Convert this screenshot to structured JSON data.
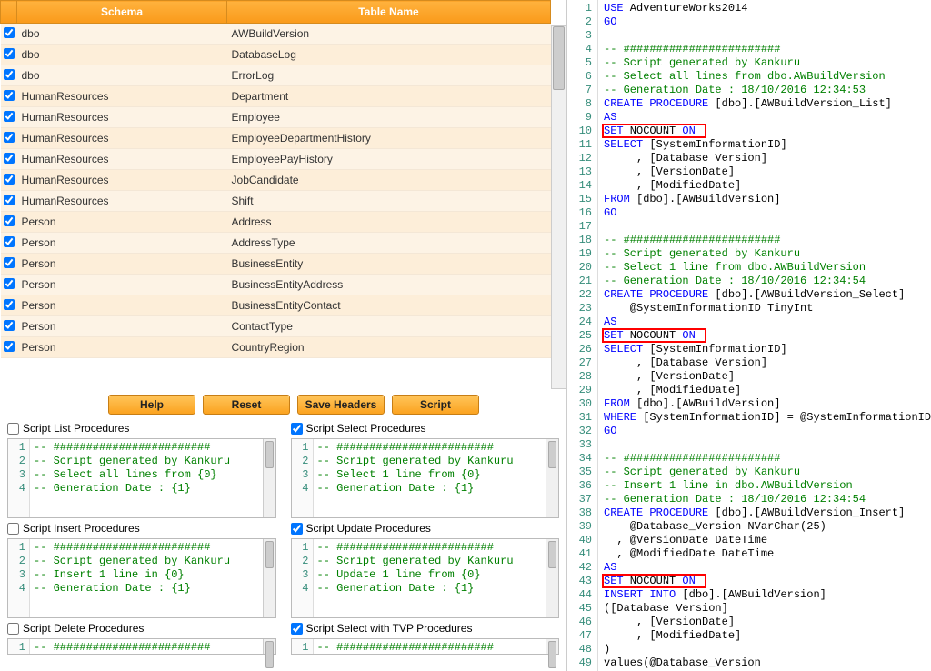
{
  "table": {
    "headers": {
      "schema": "Schema",
      "name": "Table Name"
    },
    "rows": [
      {
        "schema": "dbo",
        "name": "AWBuildVersion"
      },
      {
        "schema": "dbo",
        "name": "DatabaseLog"
      },
      {
        "schema": "dbo",
        "name": "ErrorLog"
      },
      {
        "schema": "HumanResources",
        "name": "Department"
      },
      {
        "schema": "HumanResources",
        "name": "Employee"
      },
      {
        "schema": "HumanResources",
        "name": "EmployeeDepartmentHistory"
      },
      {
        "schema": "HumanResources",
        "name": "EmployeePayHistory"
      },
      {
        "schema": "HumanResources",
        "name": "JobCandidate"
      },
      {
        "schema": "HumanResources",
        "name": "Shift"
      },
      {
        "schema": "Person",
        "name": "Address"
      },
      {
        "schema": "Person",
        "name": "AddressType"
      },
      {
        "schema": "Person",
        "name": "BusinessEntity"
      },
      {
        "schema": "Person",
        "name": "BusinessEntityAddress"
      },
      {
        "schema": "Person",
        "name": "BusinessEntityContact"
      },
      {
        "schema": "Person",
        "name": "ContactType"
      },
      {
        "schema": "Person",
        "name": "CountryRegion"
      }
    ]
  },
  "buttons": {
    "help": "Help",
    "reset": "Reset",
    "save": "Save Headers",
    "script": "Script"
  },
  "panels": {
    "list": {
      "title": "Script List Procedures",
      "checked": false,
      "lines": [
        "-- ########################",
        "-- Script generated by Kankuru",
        "-- Select all lines from {0}",
        "-- Generation Date : {1}"
      ]
    },
    "select": {
      "title": "Script Select Procedures",
      "checked": true,
      "lines": [
        "-- ########################",
        "-- Script generated by Kankuru",
        "-- Select 1 line from {0}",
        "-- Generation Date : {1}"
      ]
    },
    "insert": {
      "title": "Script Insert Procedures",
      "checked": false,
      "lines": [
        "-- ########################",
        "-- Script generated by Kankuru",
        "-- Insert 1 line in {0}",
        "-- Generation Date : {1}"
      ]
    },
    "update": {
      "title": "Script Update Procedures",
      "checked": true,
      "lines": [
        "-- ########################",
        "-- Script generated by Kankuru",
        "-- Update 1 line from {0}",
        "-- Generation Date : {1}"
      ]
    },
    "delete": {
      "title": "Script Delete Procedures",
      "checked": false,
      "lines": [
        "-- ########################"
      ]
    },
    "tvp": {
      "title": "Script Select with TVP Procedures",
      "checked": true,
      "lines": [
        "-- ########################"
      ]
    }
  },
  "sql": {
    "lines": [
      {
        "n": 1,
        "html": "<span class='kw'>USE</span> AdventureWorks2014"
      },
      {
        "n": 2,
        "html": "<span class='kw'>GO</span>"
      },
      {
        "n": 3,
        "html": ""
      },
      {
        "n": 4,
        "html": "<span class='cm'>-- ########################</span>"
      },
      {
        "n": 5,
        "html": "<span class='cm'>-- Script generated by Kankuru</span>"
      },
      {
        "n": 6,
        "html": "<span class='cm'>-- Select all lines from dbo.AWBuildVersion</span>"
      },
      {
        "n": 7,
        "html": "<span class='cm'>-- Generation Date : 18/10/2016 12:34:53</span>"
      },
      {
        "n": 8,
        "html": "<span class='kw'>CREATE</span> <span class='kw'>PROCEDURE</span> [dbo].[AWBuildVersion_List]"
      },
      {
        "n": 9,
        "html": "<span class='kw'>AS</span>"
      },
      {
        "n": 10,
        "html": "<span class='kw'>SET</span> NOCOUNT <span class='kw'>ON</span>",
        "box": true
      },
      {
        "n": 11,
        "html": "<span class='kw'>SELECT</span> [SystemInformationID]"
      },
      {
        "n": 12,
        "html": "     , [Database Version]"
      },
      {
        "n": 13,
        "html": "     , [VersionDate]"
      },
      {
        "n": 14,
        "html": "     , [ModifiedDate]"
      },
      {
        "n": 15,
        "html": "<span class='kw'>FROM</span> [dbo].[AWBuildVersion]"
      },
      {
        "n": 16,
        "html": "<span class='kw'>GO</span>"
      },
      {
        "n": 17,
        "html": ""
      },
      {
        "n": 18,
        "html": "<span class='cm'>-- ########################</span>"
      },
      {
        "n": 19,
        "html": "<span class='cm'>-- Script generated by Kankuru</span>"
      },
      {
        "n": 20,
        "html": "<span class='cm'>-- Select 1 line from dbo.AWBuildVersion</span>"
      },
      {
        "n": 21,
        "html": "<span class='cm'>-- Generation Date : 18/10/2016 12:34:54</span>"
      },
      {
        "n": 22,
        "html": "<span class='kw'>CREATE</span> <span class='kw'>PROCEDURE</span> [dbo].[AWBuildVersion_Select]"
      },
      {
        "n": 23,
        "html": "    @SystemInformationID TinyInt"
      },
      {
        "n": 24,
        "html": "<span class='kw'>AS</span>"
      },
      {
        "n": 25,
        "html": "<span class='kw'>SET</span> NOCOUNT <span class='kw'>ON</span>",
        "box": true
      },
      {
        "n": 26,
        "html": "<span class='kw'>SELECT</span> [SystemInformationID]"
      },
      {
        "n": 27,
        "html": "     , [Database Version]"
      },
      {
        "n": 28,
        "html": "     , [VersionDate]"
      },
      {
        "n": 29,
        "html": "     , [ModifiedDate]"
      },
      {
        "n": 30,
        "html": "<span class='kw'>FROM</span> [dbo].[AWBuildVersion]"
      },
      {
        "n": 31,
        "html": "<span class='kw'>WHERE</span> [SystemInformationID] = @SystemInformationID"
      },
      {
        "n": 32,
        "html": "<span class='kw'>GO</span>"
      },
      {
        "n": 33,
        "html": ""
      },
      {
        "n": 34,
        "html": "<span class='cm'>-- ########################</span>"
      },
      {
        "n": 35,
        "html": "<span class='cm'>-- Script generated by Kankuru</span>"
      },
      {
        "n": 36,
        "html": "<span class='cm'>-- Insert 1 line in dbo.AWBuildVersion</span>"
      },
      {
        "n": 37,
        "html": "<span class='cm'>-- Generation Date : 18/10/2016 12:34:54</span>"
      },
      {
        "n": 38,
        "html": "<span class='kw'>CREATE</span> <span class='kw'>PROCEDURE</span> [dbo].[AWBuildVersion_Insert]"
      },
      {
        "n": 39,
        "html": "    @Database_Version NVarChar(25)"
      },
      {
        "n": 40,
        "html": "  , @VersionDate DateTime"
      },
      {
        "n": 41,
        "html": "  , @ModifiedDate DateTime"
      },
      {
        "n": 42,
        "html": "<span class='kw'>AS</span>"
      },
      {
        "n": 43,
        "html": "<span class='kw'>SET</span> NOCOUNT <span class='kw'>ON</span>",
        "box": true
      },
      {
        "n": 44,
        "html": "<span class='kw'>INSERT INTO</span> [dbo].[AWBuildVersion]"
      },
      {
        "n": 45,
        "html": "([Database Version]"
      },
      {
        "n": 46,
        "html": "     , [VersionDate]"
      },
      {
        "n": 47,
        "html": "     , [ModifiedDate]"
      },
      {
        "n": 48,
        "html": ")"
      },
      {
        "n": 49,
        "html": "values(@Database_Version"
      }
    ]
  }
}
